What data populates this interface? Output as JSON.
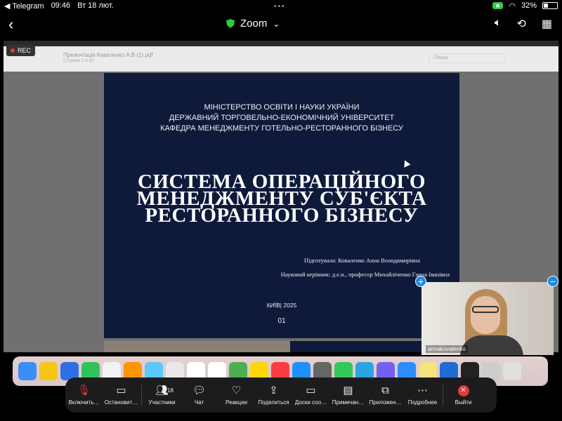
{
  "status": {
    "back_app": "◀ Telegram",
    "time": "09:46",
    "date": "Вт 18 лют.",
    "battery_percent": "32%",
    "battery_level": 0.32
  },
  "header": {
    "title": "Zoom",
    "chevron": "⌄"
  },
  "pdf_viewer": {
    "file_name": "Презентація Коваленко А.В (1).pdf",
    "page_info": "Сторінка 1 із 10",
    "search_placeholder": "Пошук"
  },
  "recording": {
    "label": "REC"
  },
  "slide": {
    "ministry_lines": [
      "МІНІСТЕРСТВО ОСВІТИ І НАУКИ УКРАЇНИ",
      "ДЕРЖАВНИЙ  ТОРГОВЕЛЬНО-ЕКОНОМІЧНИЙ УНІВЕРСИТЕТ",
      "КАФЕДРА МЕНЕДЖМЕНТУ ГОТЕЛЬНО-РЕСТОРАННОГО БІЗНЕСУ"
    ],
    "title_lines": [
      "СИСТЕМА ОПЕРАЦІЙНОГО",
      "МЕНЕДЖМЕНТУ СУБ'ЄКТА",
      "РЕСТОРАННОГО БІЗНЕСУ"
    ],
    "prepared_by": "Підготувала: Коваленко Анна Володимирівна",
    "supervisor": "Науковий керівник: д.е.н., професор Михайліченко Ганна Іванівна",
    "city_year": "КИЇВ| 2025",
    "slide_number": "01"
  },
  "video_tile": {
    "name": "annakovalenko",
    "add_label": "+",
    "minimize_label": "−"
  },
  "dock_colors": [
    "#3a8ef6",
    "#f5c518",
    "#2f6fe4",
    "#31c35b",
    "#f2f2f2",
    "#ff9500",
    "#5ac8fa",
    "#e8e8e8",
    "#ffffff",
    "#ffffff",
    "#4caf50",
    "#ffd60a",
    "#fc3c44",
    "#1e90ff",
    "#666666",
    "#34c759",
    "#2aa5e0",
    "#7360f2",
    "#2d8cff",
    "#f6e27f",
    "#1f6bd8",
    "#222222",
    "#cccccc",
    "#e0e0e0"
  ],
  "toolbar": {
    "participants_count": "18",
    "buttons": [
      {
        "label": "Включить…",
        "icon": "mic-muted-icon"
      },
      {
        "label": "Остановит…",
        "icon": "video-icon"
      },
      {
        "label": "Участники",
        "icon": "participants-icon"
      },
      {
        "label": "Чат",
        "icon": "chat-icon"
      },
      {
        "label": "Реакции",
        "icon": "heart-icon"
      },
      {
        "label": "Поделиться",
        "icon": "share-icon"
      },
      {
        "label": "Доски соо…",
        "icon": "whiteboard-icon"
      },
      {
        "label": "Примечан…",
        "icon": "notes-icon"
      },
      {
        "label": "Приложен…",
        "icon": "apps-icon"
      },
      {
        "label": "Подробнее",
        "icon": "more-icon"
      },
      {
        "label": "Выйти",
        "icon": "exit-icon"
      }
    ]
  }
}
